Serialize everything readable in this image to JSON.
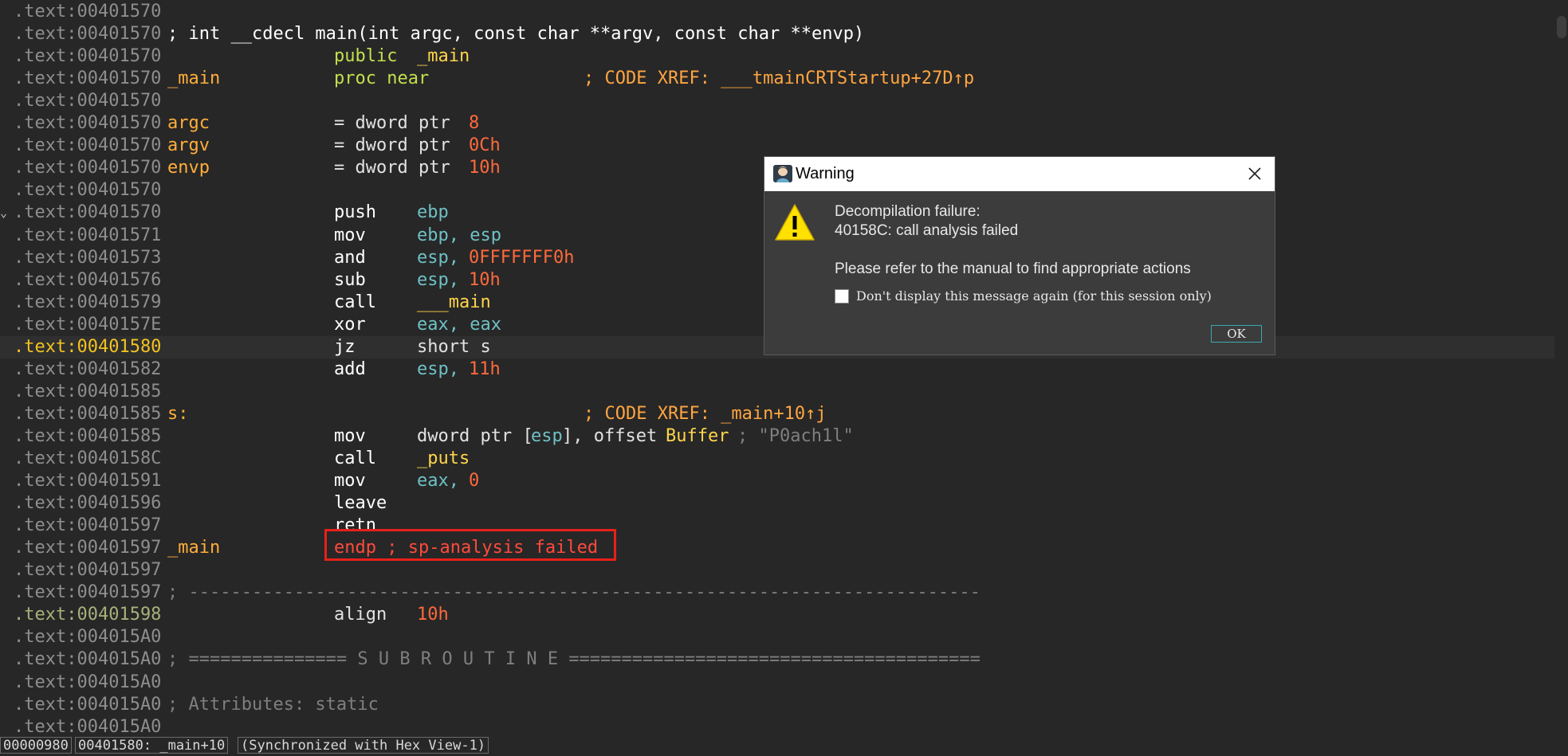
{
  "listing": {
    "lines": [
      {
        "addr": ".text:00401570",
        "tokens": []
      },
      {
        "addr": ".text:00401570",
        "tokens": [
          {
            "t": "; int __cdecl main(int argc, const char **argv, const char **envp)",
            "c": "proto",
            "col": "label"
          }
        ]
      },
      {
        "addr": ".text:00401570",
        "tokens": [
          {
            "t": "public",
            "c": "directive",
            "col": "op"
          },
          {
            "t": "_main",
            "c": "name",
            "col": "op2"
          }
        ]
      },
      {
        "addr": ".text:00401570",
        "tokens": [
          {
            "t": "_main",
            "c": "label",
            "col": "label"
          },
          {
            "t": "proc near",
            "c": "directive",
            "col": "op"
          },
          {
            "t": "; CODE XREF: ___tmainCRTStartup+27D↑p",
            "c": "xref",
            "col": "comment"
          }
        ]
      },
      {
        "addr": ".text:00401570",
        "tokens": []
      },
      {
        "addr": ".text:00401570",
        "tokens": [
          {
            "t": "argc",
            "c": "label",
            "col": "label"
          },
          {
            "t": "= dword ptr",
            "c": "plain",
            "col": "op"
          },
          {
            "t": "8",
            "c": "num",
            "col": "val"
          }
        ]
      },
      {
        "addr": ".text:00401570",
        "tokens": [
          {
            "t": "argv",
            "c": "label",
            "col": "label"
          },
          {
            "t": "= dword ptr",
            "c": "plain",
            "col": "op"
          },
          {
            "t": "0Ch",
            "c": "num",
            "col": "val"
          }
        ]
      },
      {
        "addr": ".text:00401570",
        "tokens": [
          {
            "t": "envp",
            "c": "label",
            "col": "label"
          },
          {
            "t": "= dword ptr",
            "c": "plain",
            "col": "op"
          },
          {
            "t": "10h",
            "c": "num",
            "col": "val"
          }
        ]
      },
      {
        "addr": ".text:00401570",
        "tokens": []
      },
      {
        "addr": ".text:00401570",
        "fold": true,
        "tokens": [
          {
            "t": "push",
            "c": "kw",
            "col": "op"
          },
          {
            "t": "ebp",
            "c": "reg",
            "col": "op2"
          }
        ]
      },
      {
        "addr": ".text:00401571",
        "tokens": [
          {
            "t": "mov",
            "c": "kw",
            "col": "op"
          },
          {
            "t": "ebp, esp",
            "c": "reg",
            "col": "op2"
          }
        ]
      },
      {
        "addr": ".text:00401573",
        "tokens": [
          {
            "t": "and",
            "c": "kw",
            "col": "op"
          },
          {
            "t": "esp,",
            "c": "reg",
            "col": "op2"
          },
          {
            "t": "0FFFFFFF0h",
            "c": "num",
            "col": "op3"
          }
        ]
      },
      {
        "addr": ".text:00401576",
        "tokens": [
          {
            "t": "sub",
            "c": "kw",
            "col": "op"
          },
          {
            "t": "esp,",
            "c": "reg",
            "col": "op2"
          },
          {
            "t": "10h",
            "c": "num",
            "col": "op3"
          }
        ]
      },
      {
        "addr": ".text:00401579",
        "tokens": [
          {
            "t": "call",
            "c": "kw",
            "col": "op"
          },
          {
            "t": "___main",
            "c": "name",
            "col": "op2"
          }
        ]
      },
      {
        "addr": ".text:0040157E",
        "tokens": [
          {
            "t": "xor",
            "c": "kw",
            "col": "op"
          },
          {
            "t": "eax, eax",
            "c": "reg",
            "col": "op2"
          }
        ]
      },
      {
        "addr": ".text:00401580",
        "current": true,
        "tokens": [
          {
            "t": "jz",
            "c": "kw",
            "col": "op"
          },
          {
            "t": "short s",
            "c": "plain",
            "col": "op2"
          }
        ]
      },
      {
        "addr": ".text:00401582",
        "tokens": [
          {
            "t": "add",
            "c": "kw",
            "col": "op"
          },
          {
            "t": "esp,",
            "c": "reg",
            "col": "op2"
          },
          {
            "t": "11h",
            "c": "num",
            "col": "op3"
          }
        ]
      },
      {
        "addr": ".text:00401585",
        "tokens": []
      },
      {
        "addr": ".text:00401585",
        "tokens": [
          {
            "t": "s:",
            "c": "label",
            "col": "label"
          },
          {
            "t": "; CODE XREF: _main+10↑j",
            "c": "xref",
            "col": "comment"
          }
        ]
      },
      {
        "addr": ".text:00401585",
        "tokens": [
          {
            "t": "mov",
            "c": "kw",
            "col": "op"
          },
          {
            "t": "dword ptr [",
            "c": "plain",
            "col": "op2"
          },
          {
            "t": "esp",
            "c": "reg",
            "col": "op2b"
          },
          {
            "t": "], offset",
            "c": "plain",
            "col": "op2c"
          },
          {
            "t": "Buffer",
            "c": "name",
            "col": "op2d"
          },
          {
            "t": "; \"P0ach1l\"",
            "c": "str",
            "col": "op2e"
          }
        ]
      },
      {
        "addr": ".text:0040158C",
        "tokens": [
          {
            "t": "call",
            "c": "kw",
            "col": "op"
          },
          {
            "t": "_puts",
            "c": "name",
            "col": "op2"
          }
        ]
      },
      {
        "addr": ".text:00401591",
        "tokens": [
          {
            "t": "mov",
            "c": "kw",
            "col": "op"
          },
          {
            "t": "eax,",
            "c": "reg",
            "col": "op2"
          },
          {
            "t": "0",
            "c": "num",
            "col": "op3"
          }
        ]
      },
      {
        "addr": ".text:00401596",
        "tokens": [
          {
            "t": "leave",
            "c": "kw",
            "col": "op"
          }
        ]
      },
      {
        "addr": ".text:00401597",
        "tokens": [
          {
            "t": "retn",
            "c": "kw",
            "col": "op"
          }
        ]
      },
      {
        "addr": ".text:00401597",
        "tokens": [
          {
            "t": "_main",
            "c": "label",
            "col": "label"
          },
          {
            "t": "endp ; sp-analysis failed",
            "c": "err",
            "col": "op"
          }
        ]
      },
      {
        "addr": ".text:00401597",
        "tokens": []
      },
      {
        "addr": ".text:00401597",
        "tokens": [
          {
            "t": "; ---------------------------------------------------------------------------",
            "c": "comment",
            "col": "label"
          }
        ]
      },
      {
        "addr": ".text:00401598",
        "data": true,
        "tokens": [
          {
            "t": "align",
            "c": "plain",
            "col": "op"
          },
          {
            "t": "10h",
            "c": "num",
            "col": "op2"
          }
        ]
      },
      {
        "addr": ".text:004015A0",
        "tokens": []
      },
      {
        "addr": ".text:004015A0",
        "tokens": [
          {
            "t": "; =============== S U B R O U T I N E =======================================",
            "c": "comment",
            "col": "label"
          }
        ]
      },
      {
        "addr": ".text:004015A0",
        "tokens": []
      },
      {
        "addr": ".text:004015A0",
        "tokens": [
          {
            "t": "; Attributes: static",
            "c": "comment",
            "col": "label"
          }
        ]
      },
      {
        "addr": ".text:004015A0",
        "tokens": []
      }
    ]
  },
  "status_bar": {
    "offset": "00000980",
    "location": "00401580: _main+10",
    "sync": "(Synchronized with Hex View-1)"
  },
  "dialog": {
    "title": "Warning",
    "line1": "Decompilation failure:",
    "line2": "40158C: call analysis failed",
    "line3": "Please refer to the manual to find appropriate actions",
    "checkbox_label": "Don't display this message again (for this session only)",
    "checkbox_checked": false,
    "ok_label": "OK"
  },
  "colors": {
    "background": "#272727",
    "error_box": "#e8201a",
    "warning_yellow": "#ffe100"
  }
}
